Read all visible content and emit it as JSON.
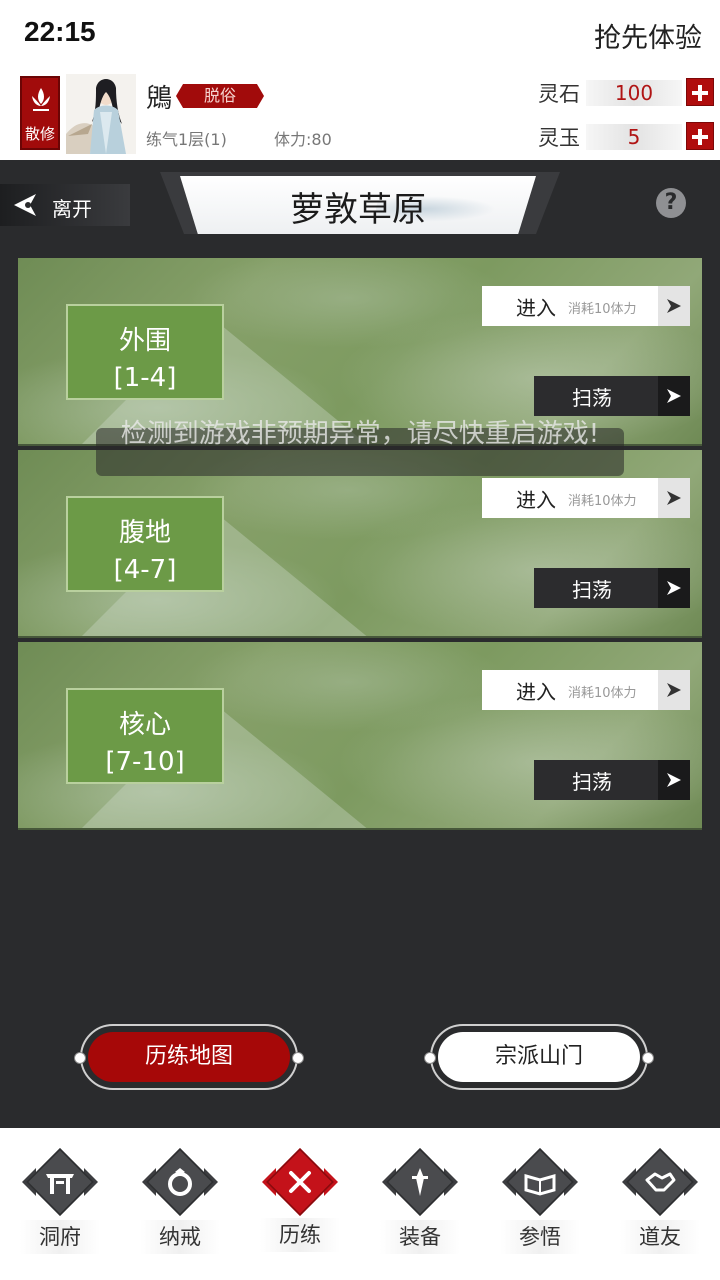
{
  "status_bar": {
    "time": "22:15",
    "trial": "抢先体验"
  },
  "player": {
    "sect_badge": "散修",
    "name": "鶂",
    "rank": "脱俗",
    "realm": "练气1层(1)",
    "stamina": "体力:80",
    "resources": [
      {
        "label": "灵石",
        "value": "100"
      },
      {
        "label": "灵玉",
        "value": "5"
      }
    ]
  },
  "header": {
    "leave": "离开",
    "title": "萝敦草原",
    "help": "?"
  },
  "zones": [
    {
      "name": "外围",
      "range": "[1-4]",
      "enter": "进入",
      "cost": "消耗10体力",
      "sweep": "扫荡"
    },
    {
      "name": "腹地",
      "range": "[4-7]",
      "enter": "进入",
      "cost": "消耗10体力",
      "sweep": "扫荡"
    },
    {
      "name": "核心",
      "range": "[7-10]",
      "enter": "进入",
      "cost": "消耗10体力",
      "sweep": "扫荡"
    }
  ],
  "toast": "检测到游戏非预期异常，请尽快重启游戏!",
  "buttons": {
    "map": "历练地图",
    "sect": "宗派山门"
  },
  "nav": [
    {
      "label": "洞府",
      "icon": "cave-gate-icon"
    },
    {
      "label": "纳戒",
      "icon": "ring-icon"
    },
    {
      "label": "历练",
      "icon": "crossed-swords-icon",
      "active": true
    },
    {
      "label": "装备",
      "icon": "dagger-icon"
    },
    {
      "label": "参悟",
      "icon": "open-book-icon"
    },
    {
      "label": "道友",
      "icon": "handshake-icon"
    }
  ],
  "colors": {
    "accent": "#a60808",
    "zone_green": "#6c9a47",
    "panel": "#2a2b2d"
  }
}
